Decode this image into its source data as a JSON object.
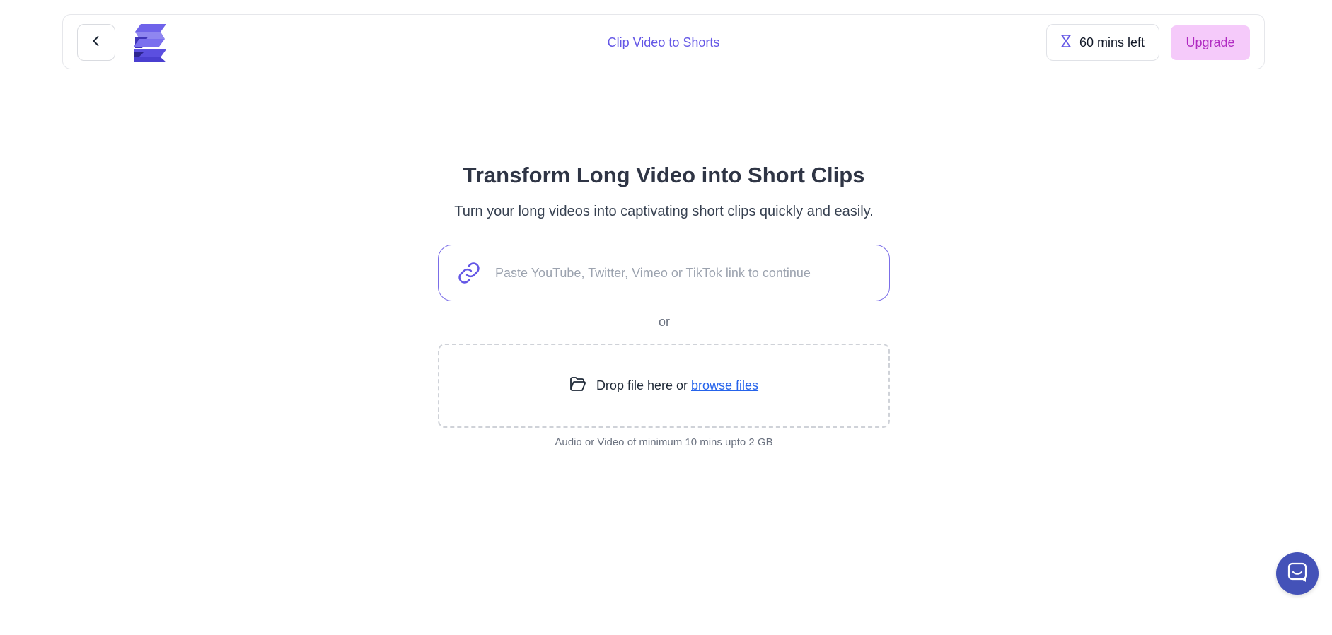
{
  "header": {
    "title": "Clip Video to Shorts",
    "credits_label": "60 mins left",
    "upgrade_label": "Upgrade",
    "back_icon": "chevron-left-icon",
    "logo_icon": "brand-logo",
    "credits_icon": "hourglass-icon"
  },
  "main": {
    "title": "Transform Long Video into Short Clips",
    "subtitle": "Turn your long videos into captivating short clips quickly and easily.",
    "url_input": {
      "placeholder": "Paste YouTube, Twitter, Vimeo or TikTok link to continue",
      "value": "",
      "icon": "link-icon"
    },
    "divider_label": "or",
    "drop_zone": {
      "text": "Drop file here or",
      "link_label": "browse files",
      "icon": "folder-open-icon"
    },
    "hint": "Audio or Video of minimum 10 mins upto 2 GB"
  },
  "chat": {
    "icon": "chat-icon"
  },
  "colors": {
    "accent": "#6457e6",
    "upgrade_bg": "#f5cafa",
    "upgrade_text": "#b12bc2",
    "link": "#2563eb",
    "chat_bg": "#4452b8"
  }
}
